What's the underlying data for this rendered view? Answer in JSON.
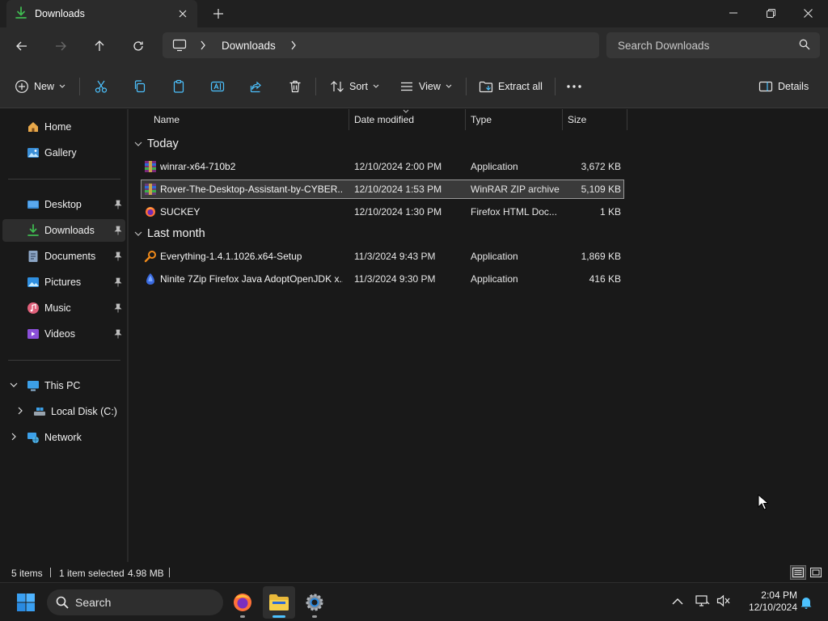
{
  "window": {
    "tab_title": "Downloads",
    "new_tab_symbol": "+"
  },
  "nav": {
    "breadcrumb": "Downloads",
    "search_placeholder": "Search Downloads"
  },
  "commands": {
    "new": "New",
    "sort": "Sort",
    "view": "View",
    "extract_all": "Extract all",
    "details": "Details"
  },
  "sidebar": {
    "quick": [
      {
        "label": "Home",
        "icon": "home-icon"
      },
      {
        "label": "Gallery",
        "icon": "gallery-icon"
      }
    ],
    "pinned": [
      {
        "label": "Desktop",
        "icon": "desktop-folder-icon"
      },
      {
        "label": "Downloads",
        "icon": "downloads-folder-icon"
      },
      {
        "label": "Documents",
        "icon": "documents-folder-icon"
      },
      {
        "label": "Pictures",
        "icon": "pictures-folder-icon"
      },
      {
        "label": "Music",
        "icon": "music-folder-icon"
      },
      {
        "label": "Videos",
        "icon": "videos-folder-icon"
      }
    ],
    "tree": [
      {
        "label": "This PC",
        "icon": "computer-icon"
      },
      {
        "label": "Local Disk (C:)",
        "icon": "drive-icon"
      },
      {
        "label": "Network",
        "icon": "network-icon"
      }
    ]
  },
  "columns": {
    "name": "Name",
    "date": "Date modified",
    "type": "Type",
    "size": "Size"
  },
  "groups": [
    {
      "title": "Today",
      "files": [
        {
          "name": "winrar-x64-710b2",
          "date": "12/10/2024 2:00 PM",
          "type": "Application",
          "size": "3,672 KB",
          "icon": "winrar-icon"
        },
        {
          "name": "Rover-The-Desktop-Assistant-by-CYBER...",
          "date": "12/10/2024 1:53 PM",
          "type": "WinRAR ZIP archive",
          "size": "5,109 KB",
          "icon": "zip-archive-icon"
        },
        {
          "name": "SUCKEY",
          "date": "12/10/2024 1:30 PM",
          "type": "Firefox HTML Doc...",
          "size": "1 KB",
          "icon": "firefox-html-icon"
        }
      ]
    },
    {
      "title": "Last month",
      "files": [
        {
          "name": "Everything-1.4.1.1026.x64-Setup",
          "date": "11/3/2024 9:43 PM",
          "type": "Application",
          "size": "1,869 KB",
          "icon": "everything-search-icon"
        },
        {
          "name": "Ninite 7Zip Firefox Java AdoptOpenJDK x...",
          "date": "11/3/2024 9:30 PM",
          "type": "Application",
          "size": "416 KB",
          "icon": "ninite-icon"
        }
      ]
    }
  ],
  "status": {
    "item_count": "5 items",
    "selection": "1 item selected",
    "selection_size": "4.98 MB"
  },
  "taskbar": {
    "search_placeholder": "Search",
    "time": "2:04 PM",
    "date": "12/10/2024"
  },
  "colors": {
    "accent": "#4cc2ff",
    "downloads_green": "#3fb950"
  }
}
